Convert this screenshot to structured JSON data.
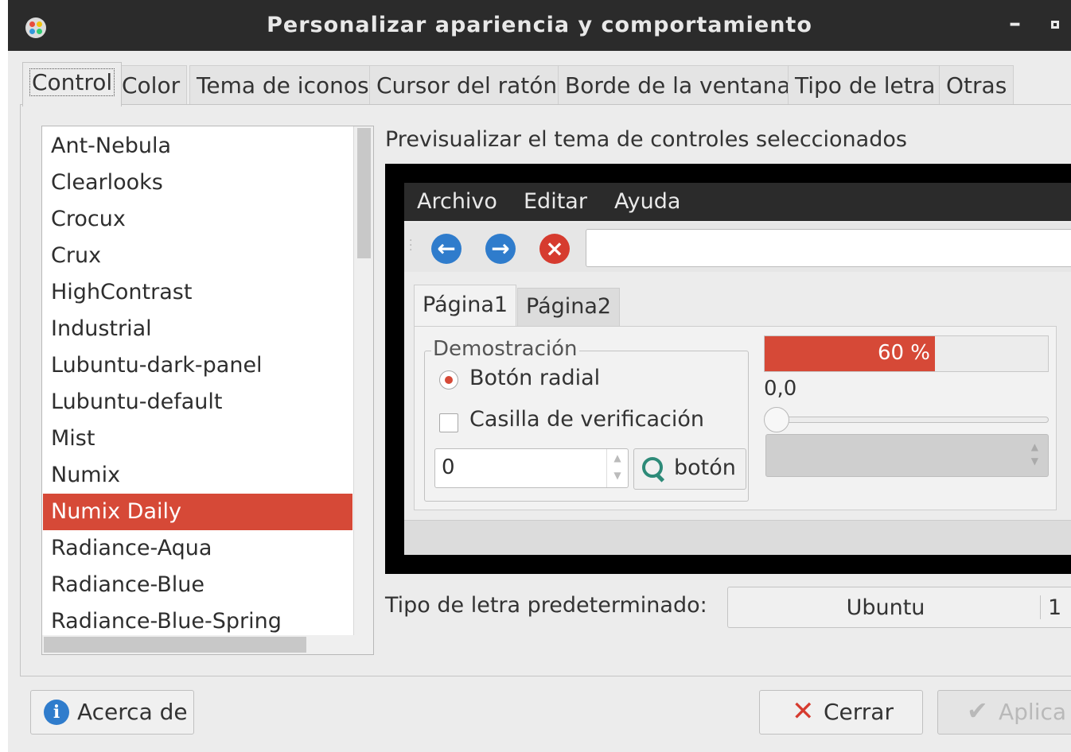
{
  "window": {
    "title": "Personalizar apariencia y comportamiento",
    "minimize_glyph": "–",
    "icons": {
      "app": "lxappearance-icon",
      "minimize": "minimize-icon",
      "maximize": "maximize-icon"
    }
  },
  "tabs": [
    {
      "label": "Control",
      "active": true
    },
    {
      "label": "Color",
      "active": false
    },
    {
      "label": "Tema de iconos",
      "active": false
    },
    {
      "label": "Cursor del ratón",
      "active": false
    },
    {
      "label": "Borde de la ventana",
      "active": false
    },
    {
      "label": "Tipo de letra",
      "active": false
    },
    {
      "label": "Otras",
      "active": false
    }
  ],
  "theme_list": {
    "items": [
      "Ant-Nebula",
      "Clearlooks",
      "Crocux",
      "Crux",
      "HighContrast",
      "Industrial",
      "Lubuntu-dark-panel",
      "Lubuntu-default",
      "Mist",
      "Numix",
      "Numix Daily",
      "Radiance-Aqua",
      "Radiance-Blue",
      "Radiance-Blue-Spring"
    ],
    "selected": "Numix Daily",
    "selection_color": "#d64937"
  },
  "preview": {
    "label": "Previsualizar el tema de controles seleccionados",
    "menu": {
      "archivo": "Archivo",
      "editar": "Editar",
      "ayuda": "Ayuda"
    },
    "toolbar": {
      "back_icon": "back-arrow-icon",
      "forward_icon": "forward-arrow-icon",
      "stop_icon": "stop-icon",
      "url_value": ""
    },
    "notebook_tabs": [
      "Página1",
      "Página2"
    ],
    "frame_label": "Demostración",
    "radio_label": "Botón radial",
    "checkbox_label": "Casilla de verificación",
    "spin_value": "0",
    "button_label": "botón",
    "progress": {
      "value": 0.6,
      "text": "60 %"
    },
    "scale_value": "0,0",
    "accent_color": "#d64937"
  },
  "font": {
    "label": "Tipo de letra predeterminado:",
    "name": "Ubuntu",
    "size_visible": "1"
  },
  "footer": {
    "about_label": "Acerca de",
    "close_label": "Cerrar",
    "apply_label": "Aplica"
  }
}
